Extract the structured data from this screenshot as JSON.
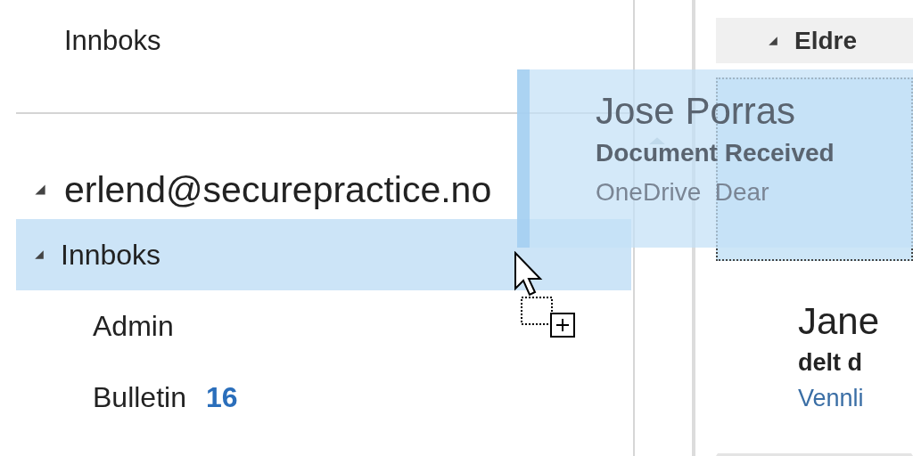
{
  "folder_pane": {
    "title": "Innboks",
    "account": {
      "name": "erlend@securepractice.no",
      "expanded": true
    },
    "folders": [
      {
        "name": "Innboks",
        "expanded": true,
        "selected": true
      },
      {
        "name": "Admin",
        "selected": false
      },
      {
        "name": "Bulletin",
        "selected": false,
        "count": "16"
      }
    ]
  },
  "message_list": {
    "group_header": "Eldre",
    "messages": [
      {
        "selected": true
      },
      {
        "sender": "Jane",
        "subject": "delt d",
        "preview": "Vennli",
        "selected": false
      }
    ]
  },
  "drag_preview": {
    "sender": "Jose Porras",
    "subject": "Document Received",
    "preview": "OneDrive  Dear"
  }
}
